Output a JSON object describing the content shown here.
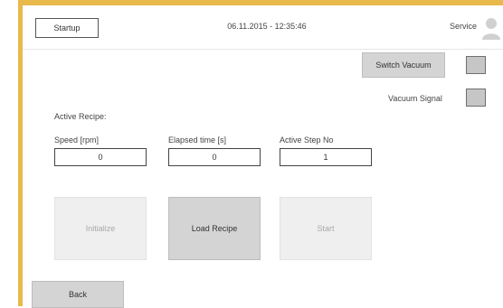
{
  "header": {
    "startup_label": "Startup",
    "datetime": "06.11.2015 - 12:35:46",
    "service_label": "Service"
  },
  "vacuum": {
    "switch_label": "Switch Vacuum",
    "signal_label": "Vacuum Signal"
  },
  "recipe": {
    "active_label": "Active Recipe:"
  },
  "fields": {
    "speed": {
      "label": "Speed [rpm]",
      "value": "0"
    },
    "elapsed": {
      "label": "Elapsed time [s]",
      "value": "0"
    },
    "step": {
      "label": "Active Step No",
      "value": "1"
    }
  },
  "actions": {
    "initialize_label": "Initialize",
    "load_recipe_label": "Load Recipe",
    "start_label": "Start",
    "back_label": "Back"
  },
  "colors": {
    "frame_accent": "#e9b94c",
    "button_gray": "#d4d4d4",
    "disabled_gray": "#efefef",
    "indicator_gray": "#c6c6c6"
  },
  "icons": {
    "user": "user-icon"
  }
}
